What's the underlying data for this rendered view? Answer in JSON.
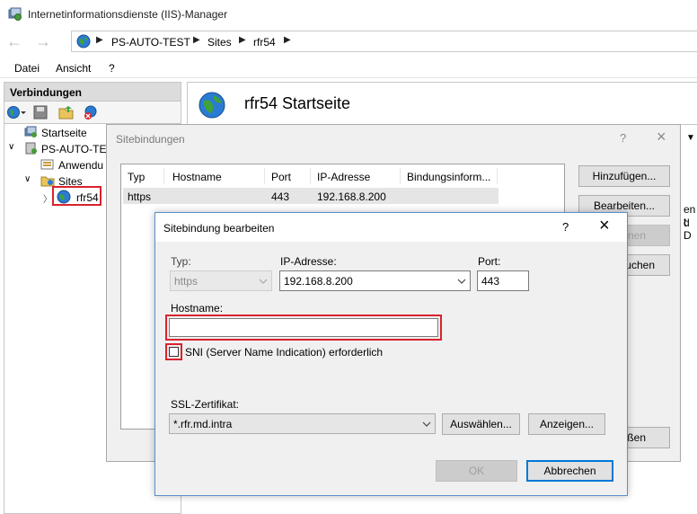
{
  "window": {
    "title": "Internetinformationsdienste (IIS)-Manager"
  },
  "breadcrumb": [
    "PS-AUTO-TEST",
    "Sites",
    "rfr54"
  ],
  "menu": [
    "Datei",
    "Ansicht",
    "?"
  ],
  "connections": {
    "header": "Verbindungen",
    "tree": [
      "Startseite",
      "PS-AUTO-TES",
      "Anwendu",
      "Sites",
      "rfr54"
    ]
  },
  "main": {
    "title": "rfr54 Startseite",
    "clipped_lines": [
      "en t",
      "d D"
    ]
  },
  "bindings_dialog": {
    "title": "Sitebindungen",
    "help": "?",
    "columns": [
      "Typ",
      "Hostname",
      "Port",
      "IP-Adresse",
      "Bindungsinform..."
    ],
    "rows": [
      {
        "typ": "https",
        "hostname": "",
        "port": "443",
        "ip": "192.168.8.200",
        "info": ""
      }
    ],
    "buttons": {
      "add": "Hinzufügen...",
      "edit": "Bearbeiten...",
      "remove": "nen",
      "browse": "uchen",
      "close": "ßen"
    }
  },
  "edit_dialog": {
    "title": "Sitebindung bearbeiten",
    "help": "?",
    "type_label": "Typ:",
    "type_value": "https",
    "ip_label": "IP-Adresse:",
    "ip_value": "192.168.8.200",
    "port_label": "Port:",
    "port_value": "443",
    "hostname_label": "Hostname:",
    "hostname_value": "",
    "sni_label": "SNI (Server Name Indication) erforderlich",
    "sni_checked": false,
    "ssl_label": "SSL-Zertifikat:",
    "ssl_value": "*.rfr.md.intra",
    "select_button": "Auswählen...",
    "view_button": "Anzeigen...",
    "ok_button": "OK",
    "cancel_button": "Abbrechen"
  },
  "colors": {
    "highlight": "#d9232e",
    "focus": "#0078d7",
    "dialog_bg": "#f0f0f0"
  }
}
